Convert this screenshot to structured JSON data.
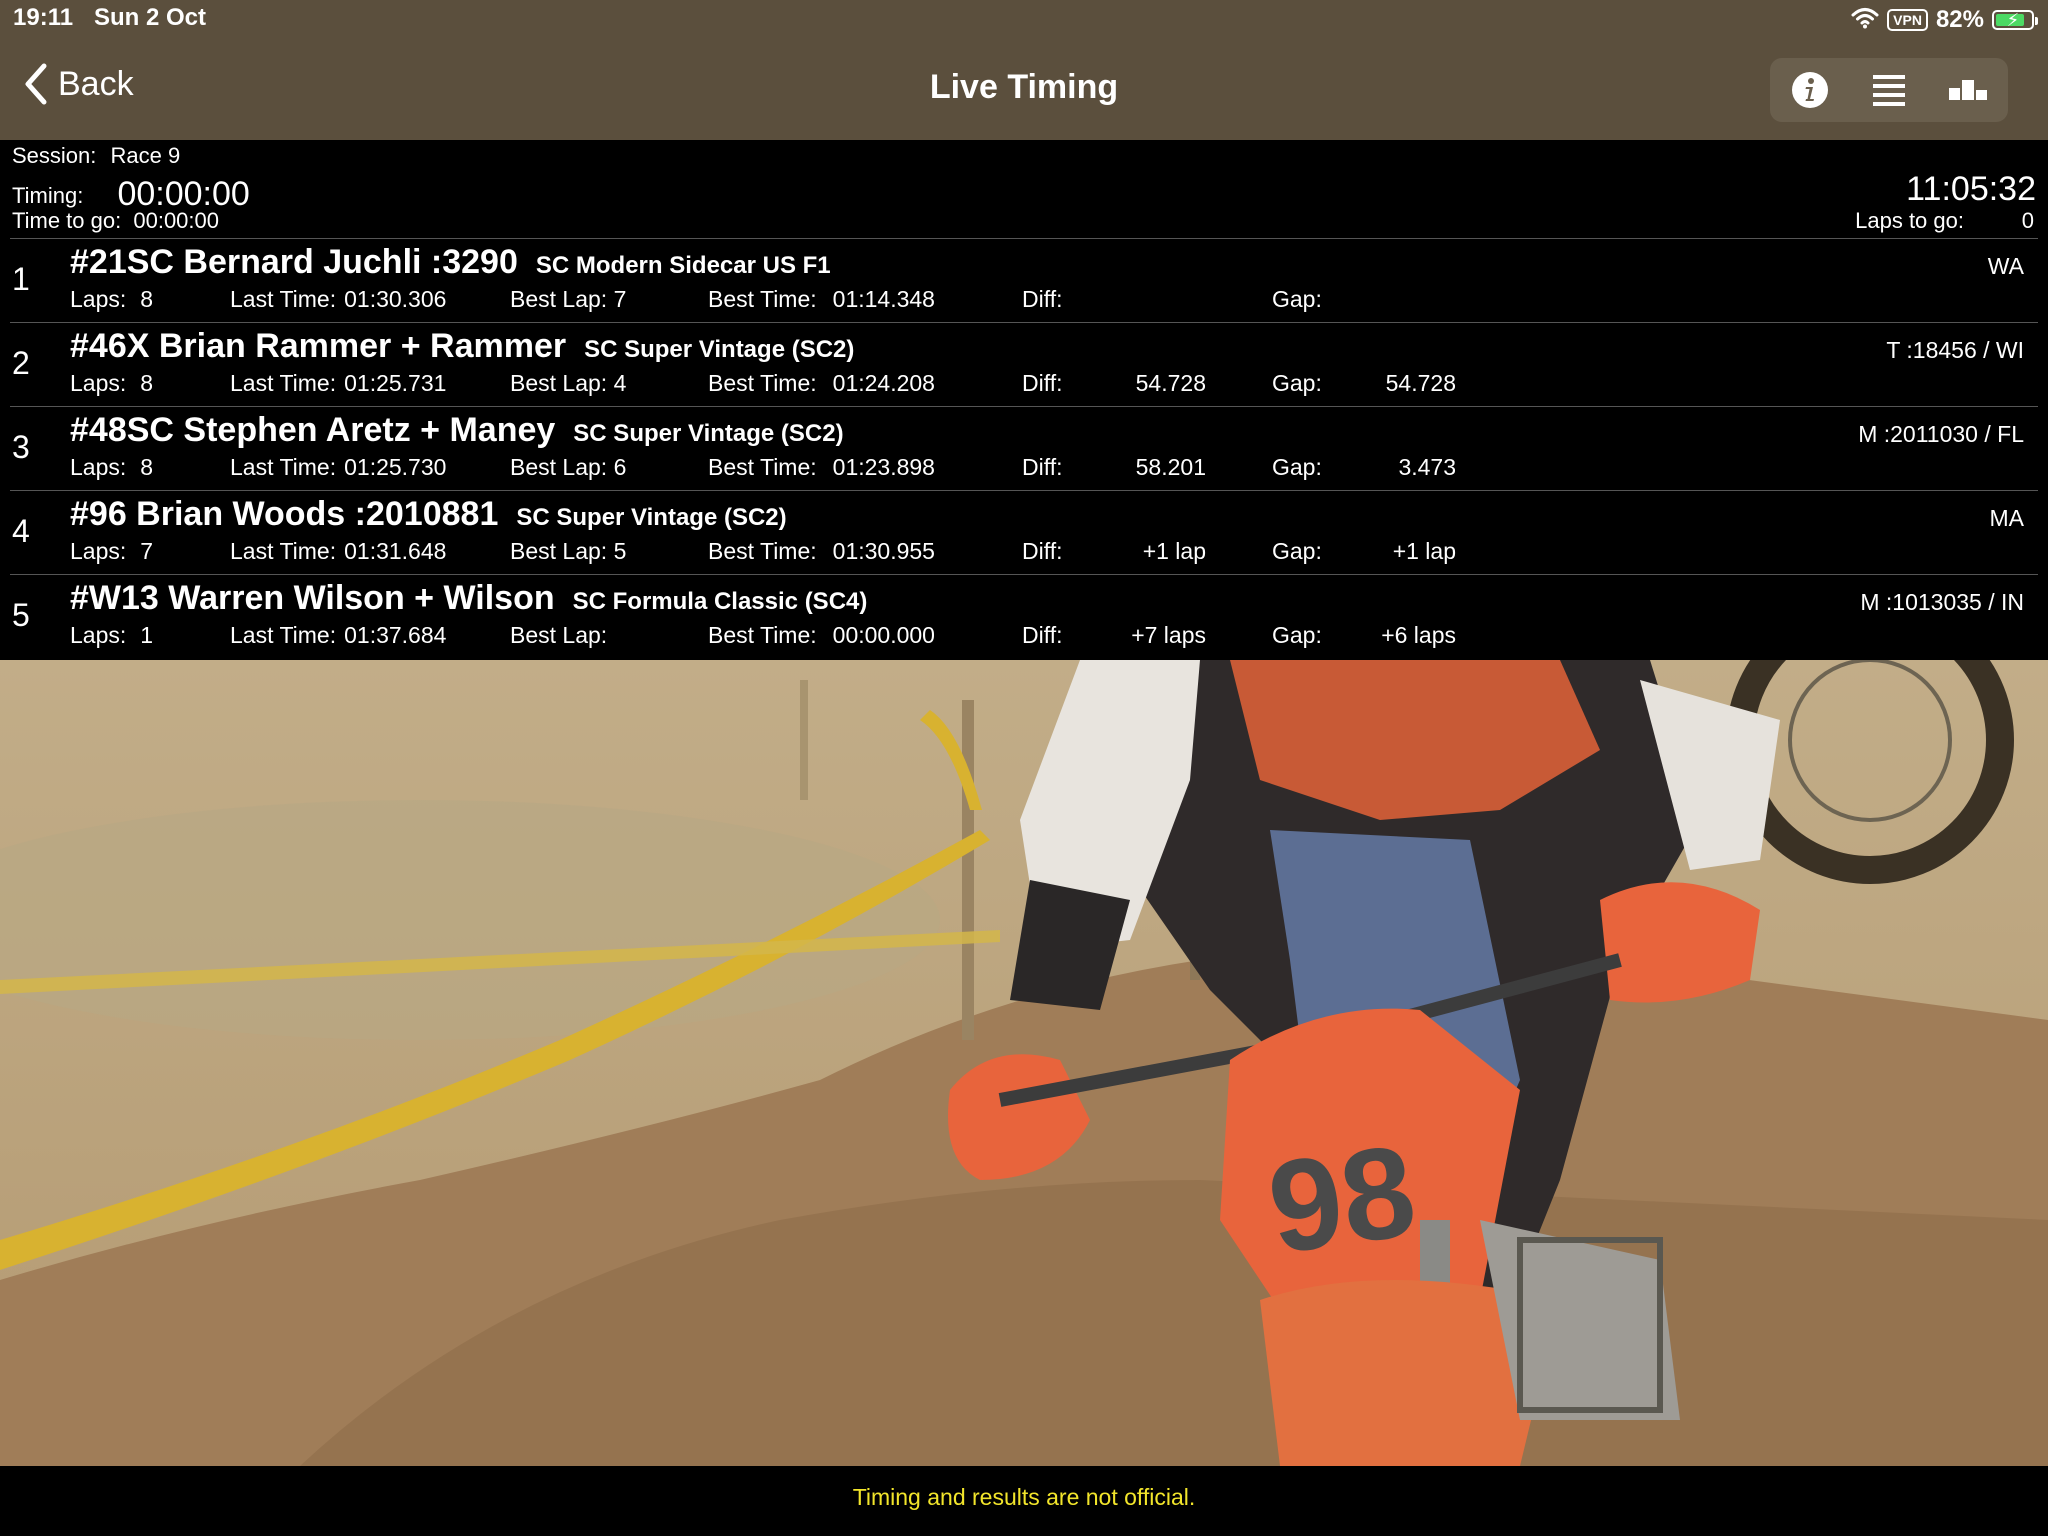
{
  "status_bar": {
    "time": "19:11",
    "date": "Sun 2 Oct",
    "vpn": "VPN",
    "battery_percent": "82%",
    "battery_level": 0.82,
    "icons": [
      "wifi-icon",
      "battery-charging-icon"
    ]
  },
  "nav": {
    "back_label": "Back",
    "title": "Live Timing",
    "toolbar_icons": [
      "info-icon",
      "list-icon",
      "podium-icon"
    ]
  },
  "session": {
    "session_label": "Session:",
    "session_value": "Race 9",
    "timing_label": "Timing:",
    "timing_value": "00:00:00",
    "time_to_go_label": "Time to go:",
    "time_to_go_value": "00:00:00",
    "clock": "11:05:32",
    "laps_to_go_label": "Laps to go:",
    "laps_to_go_value": "0"
  },
  "labels": {
    "laps": "Laps:",
    "last_time": "Last Time:",
    "best_lap": "Best Lap:",
    "best_time": "Best Time:",
    "diff": "Diff:",
    "gap": "Gap:"
  },
  "results": [
    {
      "pos": "1",
      "name": "#21SC Bernard Juchli :3290",
      "class": "SC Modern Sidecar US F1",
      "state": "WA",
      "laps": "8",
      "last_time": "01:30.306",
      "best_lap": "7",
      "best_time": "01:14.348",
      "diff": "",
      "gap": ""
    },
    {
      "pos": "2",
      "name": "#46X Brian Rammer + Rammer",
      "class": "SC Super Vintage (SC2)",
      "state": "T :18456 / WI",
      "laps": "8",
      "last_time": "01:25.731",
      "best_lap": "4",
      "best_time": "01:24.208",
      "diff": "54.728",
      "gap": "54.728"
    },
    {
      "pos": "3",
      "name": "#48SC Stephen Aretz + Maney",
      "class": "SC Super Vintage (SC2)",
      "state": "M :2011030 / FL",
      "laps": "8",
      "last_time": "01:25.730",
      "best_lap": "6",
      "best_time": "01:23.898",
      "diff": "58.201",
      "gap": "3.473"
    },
    {
      "pos": "4",
      "name": "#96 Brian Woods :2010881",
      "class": "SC Super Vintage (SC2)",
      "state": "MA",
      "laps": "7",
      "last_time": "01:31.648",
      "best_lap": "5",
      "best_time": "01:30.955",
      "diff": "+1 lap",
      "gap": "+1 lap"
    },
    {
      "pos": "5",
      "name": "#W13 Warren Wilson + Wilson",
      "class": "SC Formula Classic (SC4)",
      "state": "M :1013035 / IN",
      "laps": "1",
      "last_time": "01:37.684",
      "best_lap": "",
      "best_time": "00:00.000",
      "diff": "+7 laps",
      "gap": "+6 laps"
    }
  ],
  "photo": {
    "bike_number": "98",
    "colors": {
      "bike": "#e8643c",
      "tape": "#d8b230",
      "dirt": "#b8a07a"
    }
  },
  "footer": {
    "note": "Timing and results are not official."
  }
}
